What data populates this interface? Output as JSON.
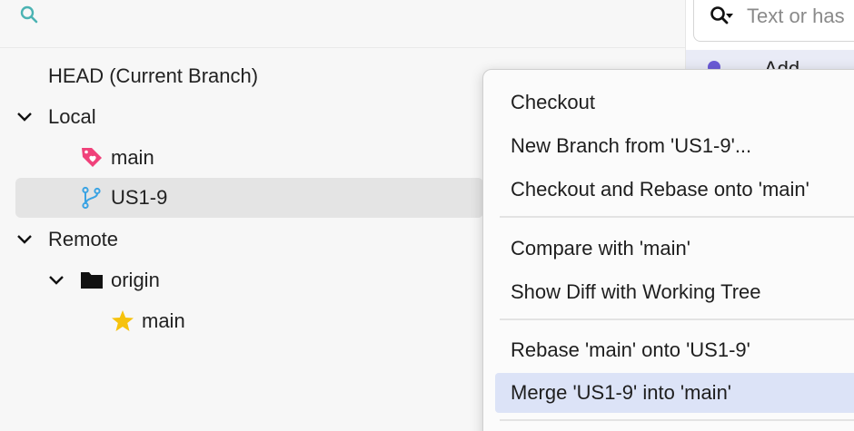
{
  "branches": {
    "head_label": "HEAD (Current Branch)",
    "local_label": "Local",
    "local_items": [
      "main",
      "US1-9"
    ],
    "remote_label": "Remote",
    "remote_folder": "origin",
    "remote_items": [
      "main"
    ]
  },
  "commits": {
    "search_placeholder": "Text or has",
    "partial_row_text": "Add ..."
  },
  "context_menu": {
    "items": [
      "Checkout",
      "New Branch from 'US1-9'...",
      "Checkout and Rebase onto 'main'",
      "Compare with 'main'",
      "Show Diff with Working Tree",
      "Rebase 'main' onto 'US1-9'",
      "Merge 'US1-9' into 'main'"
    ],
    "highlighted": "Merge 'US1-9' into 'main'"
  },
  "colors": {
    "search_icon": "#4bb3b3",
    "tag_icon": "#f0417a",
    "branch_icon": "#3aa3e3",
    "star_icon": "#f6c20d",
    "menu_highlight": "#dce3f7"
  }
}
